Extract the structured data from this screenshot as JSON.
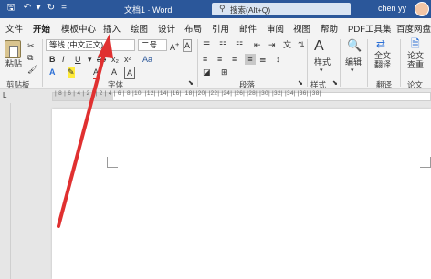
{
  "colors": {
    "titlebar": "#2b579a",
    "ribbon_bg": "#f3f3f3",
    "arrow": "#e03030"
  },
  "titlebar": {
    "doc_title": "文档1 · Word",
    "search_text": "搜索(Alt+Q)",
    "user": "chen yy"
  },
  "tabs": [
    "文件",
    "开始",
    "模板中心",
    "插入",
    "绘图",
    "设计",
    "布局",
    "引用",
    "邮件",
    "审阅",
    "视图",
    "帮助",
    "PDF工具集",
    "百度网盘"
  ],
  "ribbon": {
    "paste": "粘贴",
    "font_name": "等线 (中文正文)",
    "font_size": "二号",
    "font_group": "字体",
    "paragraph_group": "段落",
    "clipboard_group": "剪贴板",
    "style_group": "样式",
    "styles": "样式",
    "editing": "编辑",
    "translate_full": "全文\n翻译",
    "translate_group": "翻译",
    "paper_check": "论文\n查重",
    "paper_group": "论文"
  },
  "ruler_text": "L  8| 6| 4| 2|   |2| |4| |6| |8| |10| |12| |14| |16| |18| |20| |22| |24| |26| |28| |30| |32| |34| |36| |38| |40| |42"
}
